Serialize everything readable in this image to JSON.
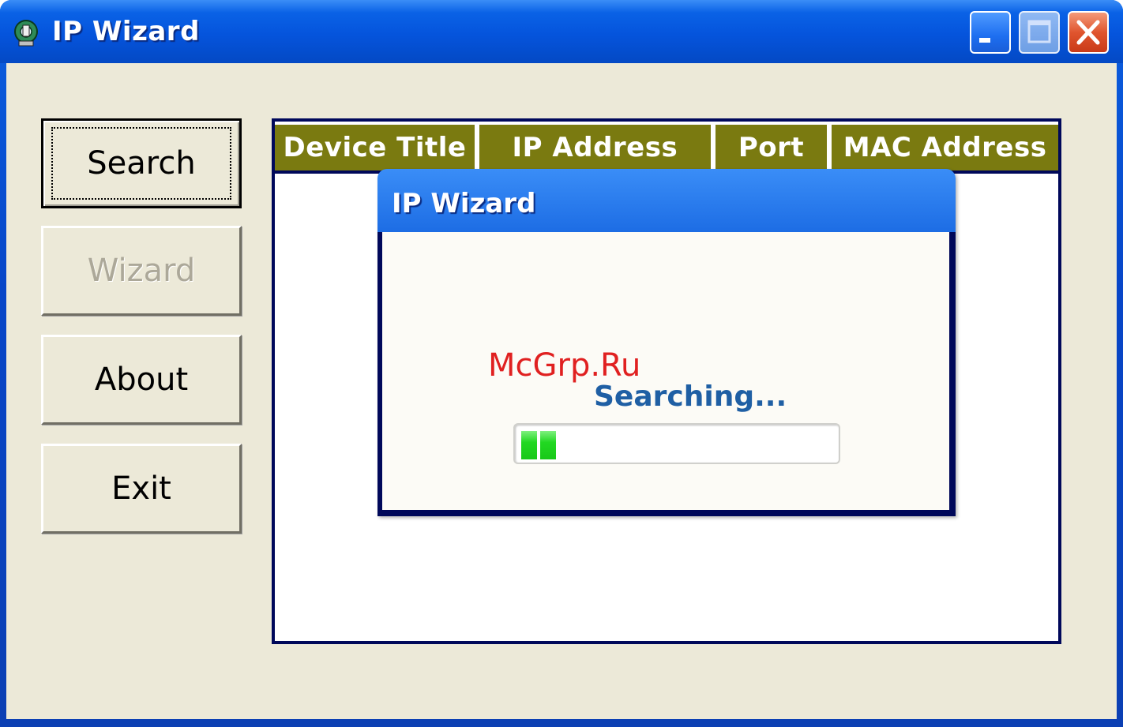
{
  "window": {
    "title": "IP Wizard",
    "controls": {
      "minimize": "minimize",
      "maximize": "maximize",
      "close": "close"
    }
  },
  "sidebar": {
    "buttons": [
      {
        "label": "Search",
        "state": "default-focused"
      },
      {
        "label": "Wizard",
        "state": "disabled"
      },
      {
        "label": "About",
        "state": "normal"
      },
      {
        "label": "Exit",
        "state": "normal"
      }
    ]
  },
  "device_list": {
    "columns": [
      "Device Title",
      "IP Address",
      "Port",
      "MAC Address"
    ],
    "rows": [],
    "header_color": "#7a7a10"
  },
  "dialog": {
    "title": "IP Wizard",
    "status": "Searching...",
    "progress_percent": 12
  },
  "watermark": "McGrp.Ru",
  "icons": {
    "app": "network-icon",
    "min": "minimize-icon",
    "max": "maximize-icon",
    "close": "close-icon"
  }
}
